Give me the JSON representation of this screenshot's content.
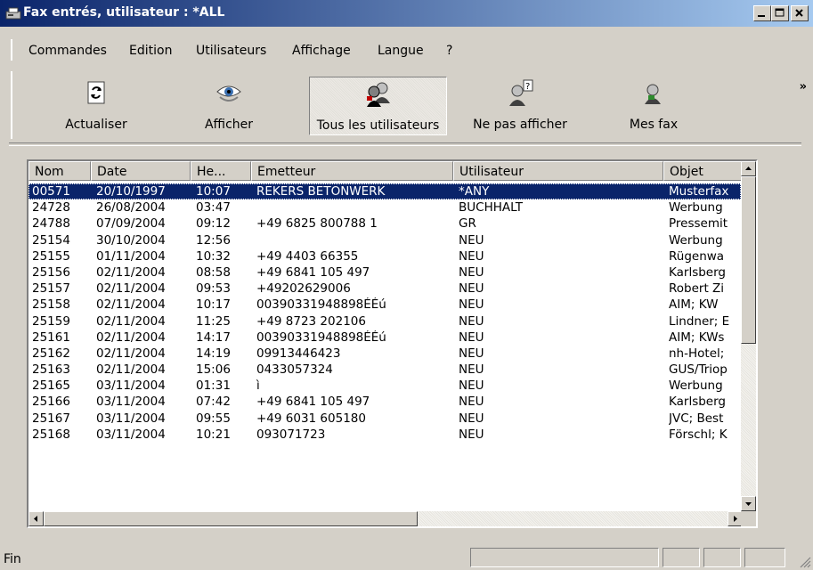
{
  "window": {
    "title": "Fax entrés, utilisateur : *ALL"
  },
  "menu": [
    "Commandes",
    "Edition",
    "Utilisateurs",
    "Affichage",
    "Langue",
    "?"
  ],
  "toolbar": [
    {
      "label": "Actualiser",
      "icon": "refresh-icon"
    },
    {
      "label": "Afficher",
      "icon": "eye-icon"
    },
    {
      "label": "Tous les utilisateurs",
      "icon": "all-users-icon",
      "pressed": true
    },
    {
      "label": "Ne pas afficher",
      "icon": "user-unknown-icon"
    },
    {
      "label": "Mes fax",
      "icon": "my-fax-icon"
    }
  ],
  "table": {
    "columns": [
      "Nom",
      "Date",
      "He...",
      "Emetteur",
      "Utilisateur",
      "Objet"
    ],
    "rows": [
      [
        "00571",
        "20/10/1997",
        "10:07",
        "REKERS BETONWERK",
        "*ANY",
        "Musterfax"
      ],
      [
        "24728",
        "26/08/2004",
        "03:47",
        "",
        "BUCHHALT",
        "Werbung"
      ],
      [
        "24788",
        "07/09/2004",
        "09:12",
        "+49 6825 800788 1",
        "GR",
        "Pressemit"
      ],
      [
        "25154",
        "30/10/2004",
        "12:56",
        "",
        "NEU",
        "Werbung"
      ],
      [
        "25155",
        "01/11/2004",
        "10:32",
        "+49 4403 66355",
        "NEU",
        "Rügenwa"
      ],
      [
        "25156",
        "02/11/2004",
        "08:58",
        "+49 6841 105 497",
        "NEU",
        "Karlsberg"
      ],
      [
        "25157",
        "02/11/2004",
        "09:53",
        "+49202629006",
        "NEU",
        "Robert Zi"
      ],
      [
        "25158",
        "02/11/2004",
        "10:17",
        "00390331948898ÉÉú",
        "NEU",
        "AIM; KW"
      ],
      [
        "25159",
        "02/11/2004",
        "11:25",
        "+49 8723 202106",
        "NEU",
        "Lindner; E"
      ],
      [
        "25161",
        "02/11/2004",
        "14:17",
        "00390331948898ÉÉú",
        "NEU",
        "AIM; KWs"
      ],
      [
        "25162",
        "02/11/2004",
        "14:19",
        "09913446423",
        "NEU",
        "nh-Hotel;"
      ],
      [
        "25163",
        "02/11/2004",
        "15:06",
        "0433057324",
        "NEU",
        "GUS/Triop"
      ],
      [
        "25165",
        "03/11/2004",
        "01:31",
        "ì",
        "NEU",
        "Werbung"
      ],
      [
        "25166",
        "03/11/2004",
        "07:42",
        "+49 6841 105 497",
        "NEU",
        "Karlsberg"
      ],
      [
        "25167",
        "03/11/2004",
        "09:55",
        "+49 6031 605180",
        "NEU",
        "JVC; Best"
      ],
      [
        "25168",
        "03/11/2004",
        "10:21",
        "093071723",
        "NEU",
        "Förschl; K"
      ]
    ],
    "selected_row": 0
  },
  "status": {
    "text": "Fin"
  },
  "colors": {
    "title_start": "#0a246a",
    "title_end": "#a6caf0",
    "selection": "#0a246a",
    "face": "#d4d0c8"
  }
}
